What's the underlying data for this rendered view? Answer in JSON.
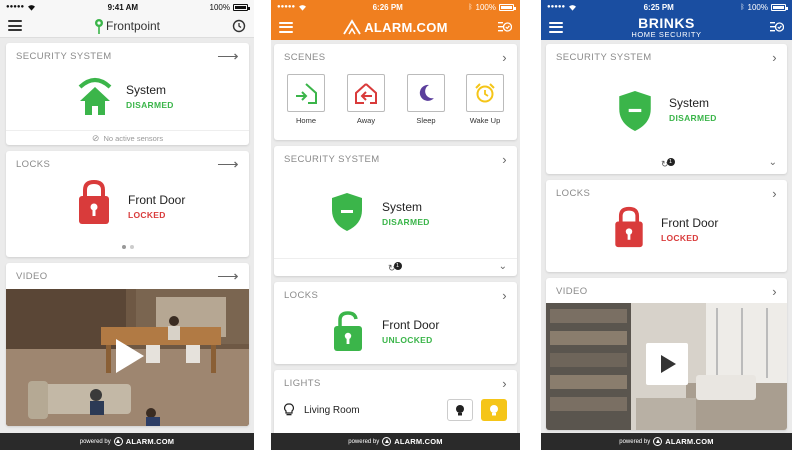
{
  "phone1": {
    "status": {
      "carrier": "●●●●●",
      "time": "9:41 AM",
      "battery": "100%"
    },
    "header": {
      "title": "Frontpoint"
    },
    "security": {
      "header": "SECURITY SYSTEM",
      "name": "System",
      "state": "DISARMED",
      "sensors": "No active sensors"
    },
    "locks": {
      "header": "LOCKS",
      "name": "Front Door",
      "state": "LOCKED"
    },
    "video": {
      "header": "VIDEO"
    },
    "footer": {
      "powered": "powered by",
      "brand": "ALARM.COM"
    }
  },
  "phone2": {
    "status": {
      "carrier": "●●●●●",
      "time": "6:26 PM",
      "battery": "100%"
    },
    "header": {
      "title": "ALARM.COM"
    },
    "scenes": {
      "header": "SCENES",
      "items": [
        {
          "label": "Home",
          "icon": "home-arrive-icon"
        },
        {
          "label": "Away",
          "icon": "away-leave-icon"
        },
        {
          "label": "Sleep",
          "icon": "moon-icon"
        },
        {
          "label": "Wake Up",
          "icon": "alarm-clock-icon"
        }
      ]
    },
    "security": {
      "header": "SECURITY SYSTEM",
      "name": "System",
      "state": "DISARMED",
      "badge": "1"
    },
    "locks": {
      "header": "LOCKS",
      "name": "Front Door",
      "state": "UNLOCKED"
    },
    "lights": {
      "header": "LIGHTS",
      "room": "Living Room"
    },
    "footer": {
      "powered": "powered by",
      "brand": "ALARM.COM"
    }
  },
  "phone3": {
    "status": {
      "carrier": "●●●●●",
      "time": "6:25 PM",
      "battery": "100%"
    },
    "header": {
      "title": "BRINKS",
      "subtitle": "HOME SECURITY"
    },
    "security": {
      "header": "SECURITY SYSTEM",
      "name": "System",
      "state": "DISARMED",
      "badge": "1"
    },
    "locks": {
      "header": "LOCKS",
      "name": "Front Door",
      "state": "LOCKED"
    },
    "video": {
      "header": "VIDEO"
    },
    "footer": {
      "powered": "powered by",
      "brand": "ALARM.COM"
    }
  },
  "colors": {
    "green": "#3bb54a",
    "red": "#d93b3b",
    "alarm_orange": "#f07f1f",
    "brinks_blue": "#1a4ea1",
    "frontpoint_green": "#3bb54a",
    "light_yellow": "#f5c518"
  }
}
